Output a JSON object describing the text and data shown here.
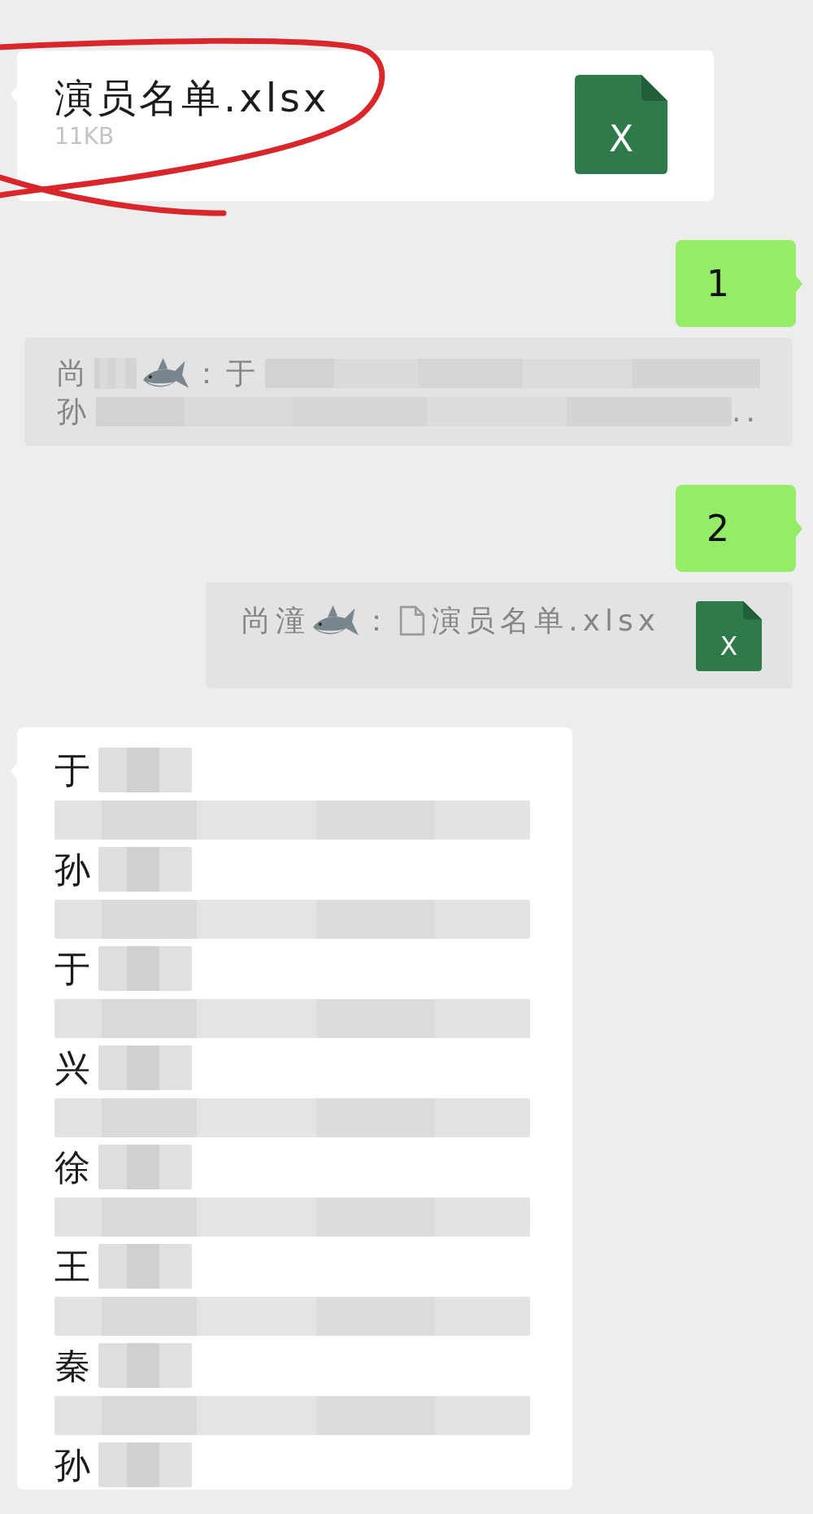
{
  "messages": [
    {
      "kind": "file",
      "outgoing": false,
      "file_name": "演员名单.xlsx",
      "file_size": "11KB",
      "icon_letter": "X",
      "annotated": true
    },
    {
      "kind": "text",
      "outgoing": true,
      "text": "1"
    },
    {
      "kind": "quote",
      "lines": [
        [
          {
            "kind": "text",
            "text": "尚"
          },
          {
            "kind": "redacted"
          },
          {
            "kind": "emoji"
          },
          {
            "kind": "text",
            "text": "：于"
          },
          {
            "kind": "redacted"
          }
        ],
        [
          {
            "kind": "text",
            "text": "孙"
          },
          {
            "kind": "redacted"
          },
          {
            "kind": "text",
            "text": ".."
          }
        ]
      ]
    },
    {
      "kind": "text",
      "outgoing": true,
      "text": "2"
    },
    {
      "kind": "quote",
      "lines": [
        [
          {
            "kind": "text",
            "text": "尚潼"
          },
          {
            "kind": "emoji"
          },
          {
            "kind": "text",
            "text": "："
          },
          {
            "kind": "document"
          },
          {
            "kind": "text",
            "text": "演员名单.xlsx"
          }
        ]
      ],
      "preview_letter": "X"
    },
    {
      "kind": "list",
      "outgoing": false,
      "lines": [
        [
          {
            "kind": "text",
            "text": "于"
          },
          {
            "kind": "redacted"
          }
        ],
        [
          {
            "kind": "redacted"
          }
        ],
        [
          {
            "kind": "text",
            "text": "孙"
          },
          {
            "kind": "redacted"
          }
        ],
        [
          {
            "kind": "redacted"
          }
        ],
        [
          {
            "kind": "text",
            "text": "于"
          },
          {
            "kind": "redacted"
          }
        ],
        [
          {
            "kind": "redacted"
          }
        ],
        [
          {
            "kind": "text",
            "text": "兴"
          },
          {
            "kind": "redacted"
          }
        ],
        [
          {
            "kind": "redacted"
          }
        ],
        [
          {
            "kind": "text",
            "text": "徐"
          },
          {
            "kind": "redacted"
          }
        ],
        [
          {
            "kind": "redacted"
          }
        ],
        [
          {
            "kind": "text",
            "text": "王"
          },
          {
            "kind": "redacted"
          }
        ],
        [
          {
            "kind": "redacted"
          }
        ],
        [
          {
            "kind": "text",
            "text": "秦"
          },
          {
            "kind": "redacted"
          }
        ],
        [
          {
            "kind": "redacted"
          }
        ],
        [
          {
            "kind": "text",
            "text": "孙"
          },
          {
            "kind": "redacted"
          }
        ]
      ]
    }
  ]
}
